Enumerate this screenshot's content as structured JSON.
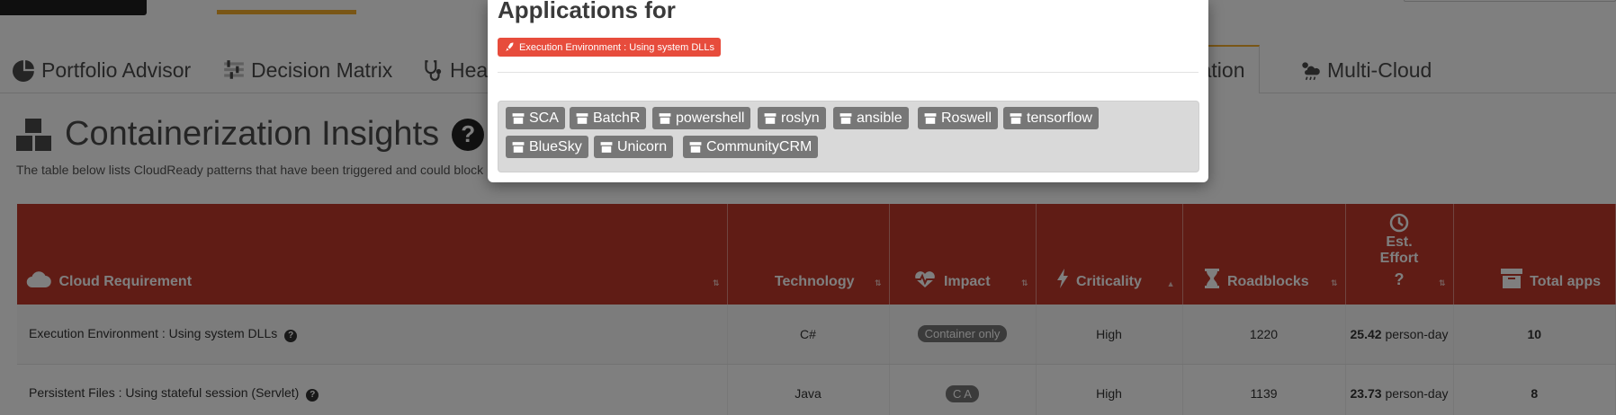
{
  "tabs": [
    {
      "label": "Portfolio Advisor",
      "icon": "pie-chart-icon"
    },
    {
      "label": "Decision Matrix",
      "icon": "sliders-icon"
    },
    {
      "label": "Heal",
      "icon": "stethoscope-icon"
    },
    {
      "label": "ization",
      "icon": "box-icon"
    },
    {
      "label": "Multi-Cloud",
      "icon": "cloud-sun-rain-icon"
    }
  ],
  "section": {
    "title": "Containerization Insights",
    "help": "?",
    "description": "The table below lists CloudReady patterns that have been triggered and could block"
  },
  "table": {
    "headers": {
      "requirement": "Cloud Requirement",
      "technology": "Technology",
      "impact": "Impact",
      "criticality": "Criticality",
      "roadblocks": "Roadblocks",
      "effort_line1": "Est.",
      "effort_line2": "Effort",
      "effort_help": "?",
      "total_apps": "Total apps"
    },
    "rows": [
      {
        "requirement": "Execution Environment : Using system DLLs",
        "technology": "C#",
        "impact": "Container only",
        "criticality": "High",
        "roadblocks": "1220",
        "effort_value": "25.42",
        "effort_unit": "person-day",
        "total_apps": "10"
      },
      {
        "requirement": "Persistent Files : Using stateful session (Servlet)",
        "technology": "Java",
        "impact": "C A",
        "criticality": "High",
        "roadblocks": "1139",
        "effort_value": "23.73",
        "effort_unit": "person-day",
        "total_apps": "8"
      }
    ]
  },
  "modal": {
    "title": "Applications for",
    "badge": "Execution Environment : Using system DLLs",
    "apps": [
      "SCA",
      "BatchR",
      "powershell",
      "roslyn",
      "ansible",
      "Roswell",
      "tensorflow",
      "BlueSky",
      "Unicorn",
      "CommunityCRM"
    ]
  },
  "colors": {
    "header_red": "#c0392b",
    "badge_red": "#e74c3c",
    "accent": "#f2ad2c",
    "tag_gray": "#777777"
  }
}
